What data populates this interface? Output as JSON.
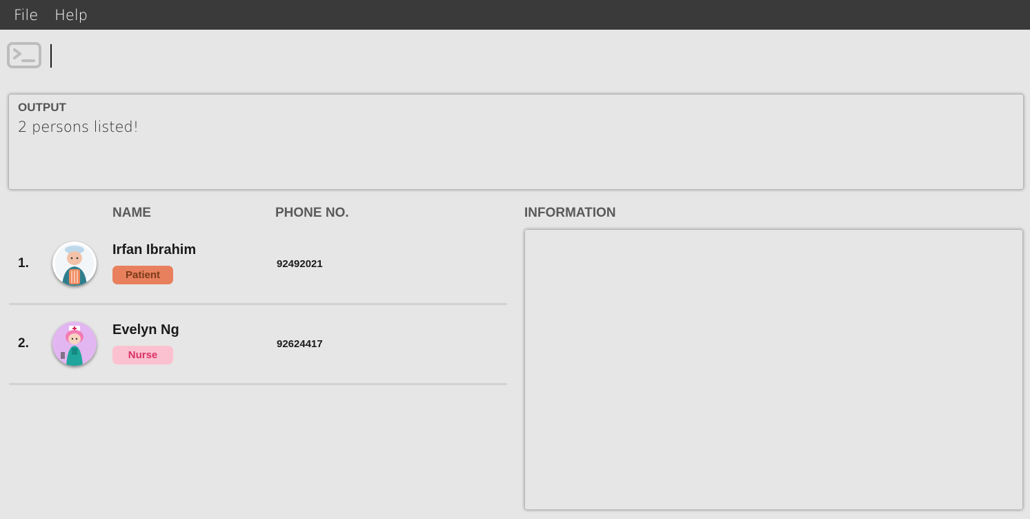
{
  "menu": {
    "items": [
      {
        "label": "File"
      },
      {
        "label": "Help"
      }
    ]
  },
  "command": {
    "icon": "terminal-icon",
    "value": ""
  },
  "output": {
    "label": "OUTPUT",
    "text": "2 persons listed!"
  },
  "list": {
    "headers": {
      "name": "NAME",
      "phone": "PHONE NO."
    },
    "persons": [
      {
        "index": "1.",
        "name": "Irfan Ibrahim",
        "tag": "Patient",
        "phone": "92492021",
        "avatar": "patient-avatar"
      },
      {
        "index": "2.",
        "name": "Evelyn Ng",
        "tag": "Nurse",
        "phone": "92624417",
        "avatar": "nurse-avatar"
      }
    ]
  },
  "info": {
    "label": "INFORMATION"
  },
  "colors": {
    "menubar": "#3a3a3a",
    "background": "#e6e6e6",
    "patient_tag": "#e8805e",
    "nurse_tag": "#fcc1d0"
  }
}
